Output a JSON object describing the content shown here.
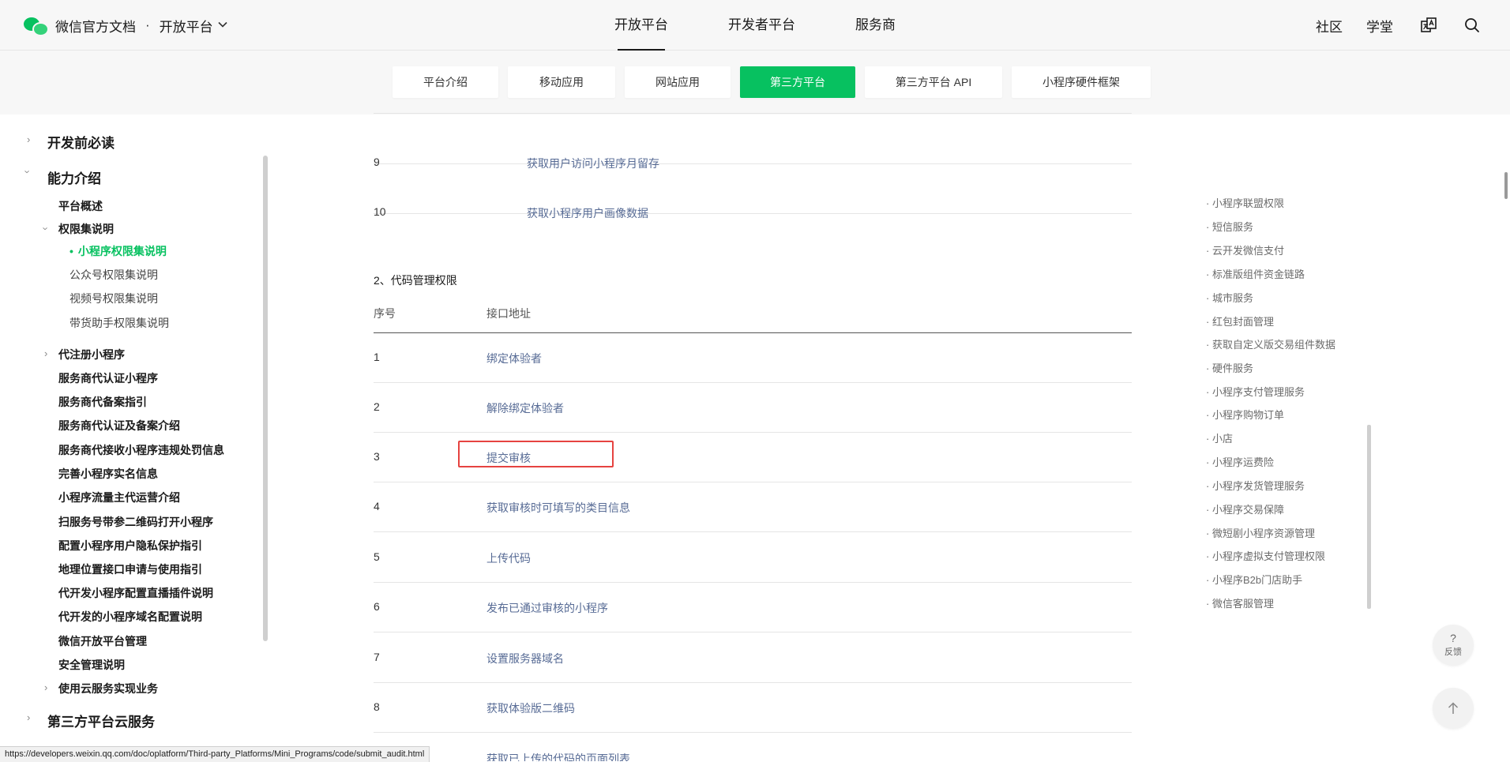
{
  "header": {
    "brand_title": "微信官方文档",
    "separator": "·",
    "platform_selector": "开放平台",
    "nav": [
      "开放平台",
      "开发者平台",
      "服务商"
    ],
    "right_links": [
      "社区",
      "学堂"
    ],
    "icons": [
      "wechat-logo-icon",
      "chevron-down-icon",
      "translate-icon",
      "search-icon"
    ]
  },
  "tabs": [
    "平台介绍",
    "移动应用",
    "网站应用",
    "第三方平台",
    "第三方平台 API",
    "小程序硬件框架"
  ],
  "active_tab": "第三方平台",
  "sidebar": {
    "read_first": "开发前必读",
    "capabilities": "能力介绍",
    "platform_overview": "平台概述",
    "permission_set": "权限集说明",
    "perm_children": [
      "小程序权限集说明",
      "公众号权限集说明",
      "视频号权限集说明",
      "带货助手权限集说明"
    ],
    "register_miniprogram": "代注册小程序",
    "items": [
      "服务商代认证小程序",
      "服务商代备案指引",
      "服务商代认证及备案介绍",
      "服务商代接收小程序违规处罚信息",
      "完善小程序实名信息",
      "小程序流量主代运营介绍",
      "扫服务号带参二维码打开小程序",
      "配置小程序用户隐私保护指引",
      "地理位置接口申请与使用指引",
      "代开发小程序配置直播插件说明",
      "代开发的小程序域名配置说明",
      "微信开放平台管理",
      "安全管理说明"
    ],
    "cloud_business": "使用云服务实现业务",
    "third_party_cloud": "第三方平台云服务"
  },
  "content": {
    "prev_rows": [
      {
        "num": "9",
        "link": "获取用户访问小程序月留存"
      },
      {
        "num": "10",
        "link": "获取小程序用户画像数据"
      }
    ],
    "section_title": "2、代码管理权限",
    "table_headers": [
      "序号",
      "接口地址"
    ],
    "rows": [
      {
        "num": "1",
        "link": "绑定体验者"
      },
      {
        "num": "2",
        "link": "解除绑定体验者"
      },
      {
        "num": "3",
        "link": "提交审核"
      },
      {
        "num": "4",
        "link": "获取审核时可填写的类目信息"
      },
      {
        "num": "5",
        "link": "上传代码"
      },
      {
        "num": "6",
        "link": "发布已通过审核的小程序"
      },
      {
        "num": "7",
        "link": "设置服务器域名"
      },
      {
        "num": "8",
        "link": "获取体验版二维码"
      },
      {
        "num": "",
        "link": "获取已上传的代码的页面列表"
      }
    ]
  },
  "toc": [
    "小程序联盟权限",
    "短信服务",
    "云开发微信支付",
    "标准版组件资金链路",
    "城市服务",
    "红包封面管理",
    "获取自定义版交易组件数据",
    "硬件服务",
    "小程序支付管理服务",
    "小程序购物订单",
    "小店",
    "小程序运费险",
    "小程序发货管理服务",
    "小程序交易保障",
    "微短剧小程序资源管理",
    "小程序虚拟支付管理权限",
    "小程序B2b门店助手",
    "微信客服管理"
  ],
  "toc_bullet": "·",
  "feedback": {
    "symbol": "?",
    "label": "反馈"
  },
  "status_url": "https://developers.weixin.qq.com/doc/oplatform/Third-party_Platforms/Mini_Programs/code/submit_audit.html",
  "colors": {
    "accent": "#07c160",
    "link": "#576b95",
    "highlight": "#e64340"
  }
}
